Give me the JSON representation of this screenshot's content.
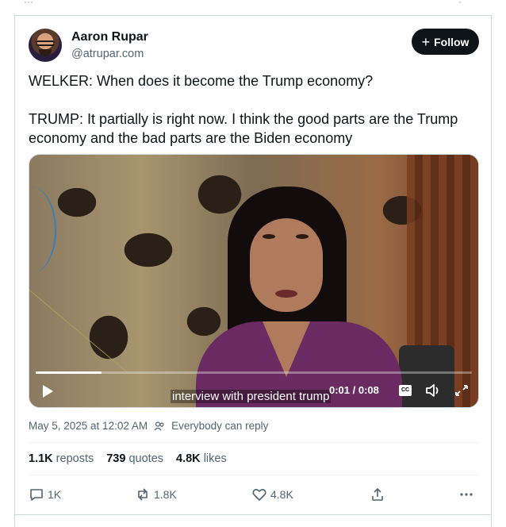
{
  "top": {
    "left_stub": "···",
    "right_stub": "·"
  },
  "author": {
    "name": "Aaron Rupar",
    "handle": "@atrupar.com"
  },
  "follow": {
    "label": "Follow"
  },
  "tweet": {
    "text": "WELKER: When does it become the Trump economy?\n\nTRUMP: It partially is right now. I think the good parts are the Trump economy and the bad parts are the Biden economy"
  },
  "video": {
    "caption": "interview with president trump",
    "time": "0:01 / 0:08",
    "cc_label": "CC",
    "progress": 0.15
  },
  "meta": {
    "timestamp": "May 5, 2025 at 12:02 AM",
    "reply_setting": "Everybody can reply"
  },
  "stats": {
    "reposts_count": "1.1K",
    "reposts_label": "reposts",
    "quotes_count": "739",
    "quotes_label": "quotes",
    "likes_count": "4.8K",
    "likes_label": "likes"
  },
  "actions": {
    "replies": "1K",
    "reposts": "1.8K",
    "likes": "4.8K"
  },
  "colors": {
    "follow_bg": "#0f1419",
    "secondary_text": "#536471",
    "border": "#cfd9de"
  }
}
